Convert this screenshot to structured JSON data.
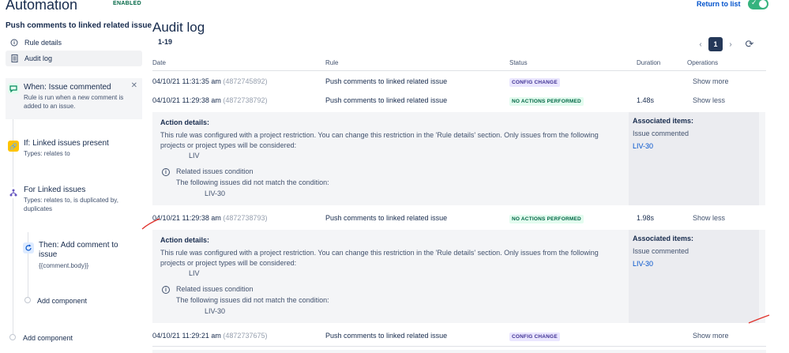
{
  "header": {
    "app_title": "Automation",
    "enabled_badge": "ENABLED",
    "return_link": "Return to list"
  },
  "sidebar": {
    "rule_name": "Push comments to linked related issue",
    "items": [
      {
        "label": "Rule details",
        "icon": "info-icon"
      },
      {
        "label": "Audit log",
        "icon": "document-icon"
      }
    ]
  },
  "flow": {
    "trigger": {
      "title": "When: Issue commented",
      "desc": "Rule is run when a new comment is added to an issue."
    },
    "condition": {
      "title": "If: Linked issues present",
      "desc": "Types: relates to"
    },
    "branch": {
      "title": "For Linked issues",
      "desc": "Types: relates to, is duplicated by, duplicates"
    },
    "action": {
      "title": "Then: Add comment to issue",
      "desc": "{{comment.body}}"
    },
    "add_component_inner": "Add component",
    "add_component_outer": "Add component"
  },
  "audit": {
    "title": "Audit log",
    "range": "1-19",
    "current_page": "1",
    "columns": [
      "Date",
      "Rule",
      "Status",
      "Duration",
      "Operations"
    ],
    "rows": [
      {
        "date": "04/10/21 11:31:35 am",
        "id": "(4872745892)",
        "rule": "Push comments to linked related issue",
        "status": "CONFIG CHANGE",
        "duration": "",
        "op": "Show more"
      },
      {
        "date": "04/10/21 11:29:38 am",
        "id": "(4872738792)",
        "rule": "Push comments to linked related issue",
        "status": "NO ACTIONS PERFORMED",
        "duration": "1.48s",
        "op": "Show less"
      },
      {
        "date": "04/10/21 11:29:38 am",
        "id": "(4872738793)",
        "rule": "Push comments to linked related issue",
        "status": "NO ACTIONS PERFORMED",
        "duration": "1.98s",
        "op": "Show less"
      },
      {
        "date": "04/10/21 11:29:21 am",
        "id": "(4872737675)",
        "rule": "Push comments to linked related issue",
        "status": "CONFIG CHANGE",
        "duration": "",
        "op": "Show more"
      }
    ],
    "details": {
      "heading": "Action details:",
      "message": "This rule was configured with a project restriction. You can change this restriction in the 'Rule details' section. Only issues from the following projects or project types will be considered:",
      "project": "LIV",
      "cond_title": "Related issues condition",
      "cond_sub": "The following issues did not match the condition:",
      "cond_issue": "LIV-30",
      "assoc_heading": "Associated items:",
      "assoc_value": "Issue commented",
      "assoc_link": "LIV-30"
    }
  },
  "colors": {
    "accent": "#0052cc",
    "toggle_on": "#36b37e",
    "config_lozenge": "#eae6ff",
    "success_lozenge": "#e3fcef"
  }
}
